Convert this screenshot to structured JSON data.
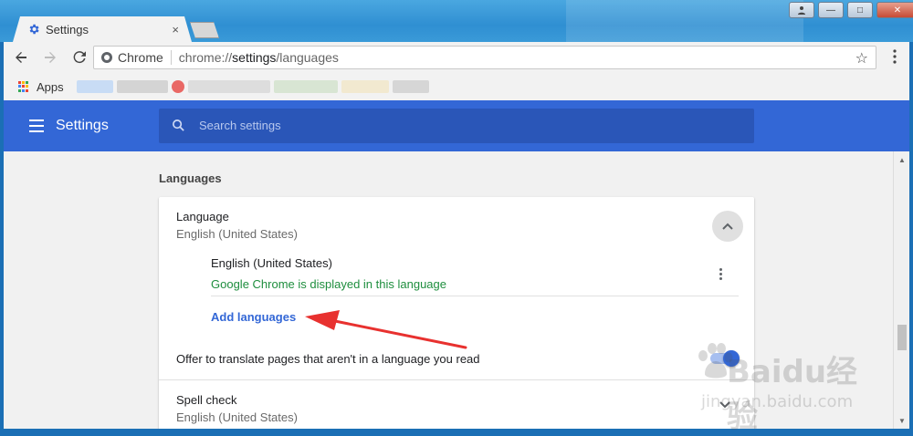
{
  "window": {
    "tab_title": "Settings",
    "tab_close": "×",
    "controls": {
      "minimize": "—",
      "maximize": "□",
      "close": "✕"
    }
  },
  "toolbar": {
    "scheme_label": "Chrome",
    "url_prefix": "chrome://",
    "url_host": "settings",
    "url_path": "/languages"
  },
  "bookmarks": {
    "apps_label": "Apps"
  },
  "header": {
    "title": "Settings",
    "search_placeholder": "Search settings"
  },
  "content": {
    "section_title": "Languages",
    "language": {
      "title": "Language",
      "subtitle": "English (United States)",
      "items": [
        {
          "name": "English (United States)",
          "note": "Google Chrome is displayed in this language"
        }
      ],
      "add_languages": "Add languages",
      "offer_translate": "Offer to translate pages that aren't in a language you read",
      "offer_translate_enabled": true
    },
    "spell_check": {
      "title": "Spell check",
      "subtitle": "English (United States)"
    }
  },
  "watermark": {
    "brand": "Baidu经验",
    "url": "jingyan.baidu.com"
  },
  "colors": {
    "header_blue": "#3367d6",
    "link_blue": "#3367d6",
    "success_green": "#1e8e3e",
    "annotation_red": "#e8312f"
  },
  "icons": {
    "tab": "gear-icon",
    "back": "back-arrow-icon",
    "forward": "forward-arrow-icon",
    "reload": "reload-icon",
    "star": "bookmark-star-icon",
    "menu": "more-vert-icon",
    "search": "search-icon",
    "expand": "chevron-up-icon",
    "spell_expand": "chevron-down-icon"
  }
}
